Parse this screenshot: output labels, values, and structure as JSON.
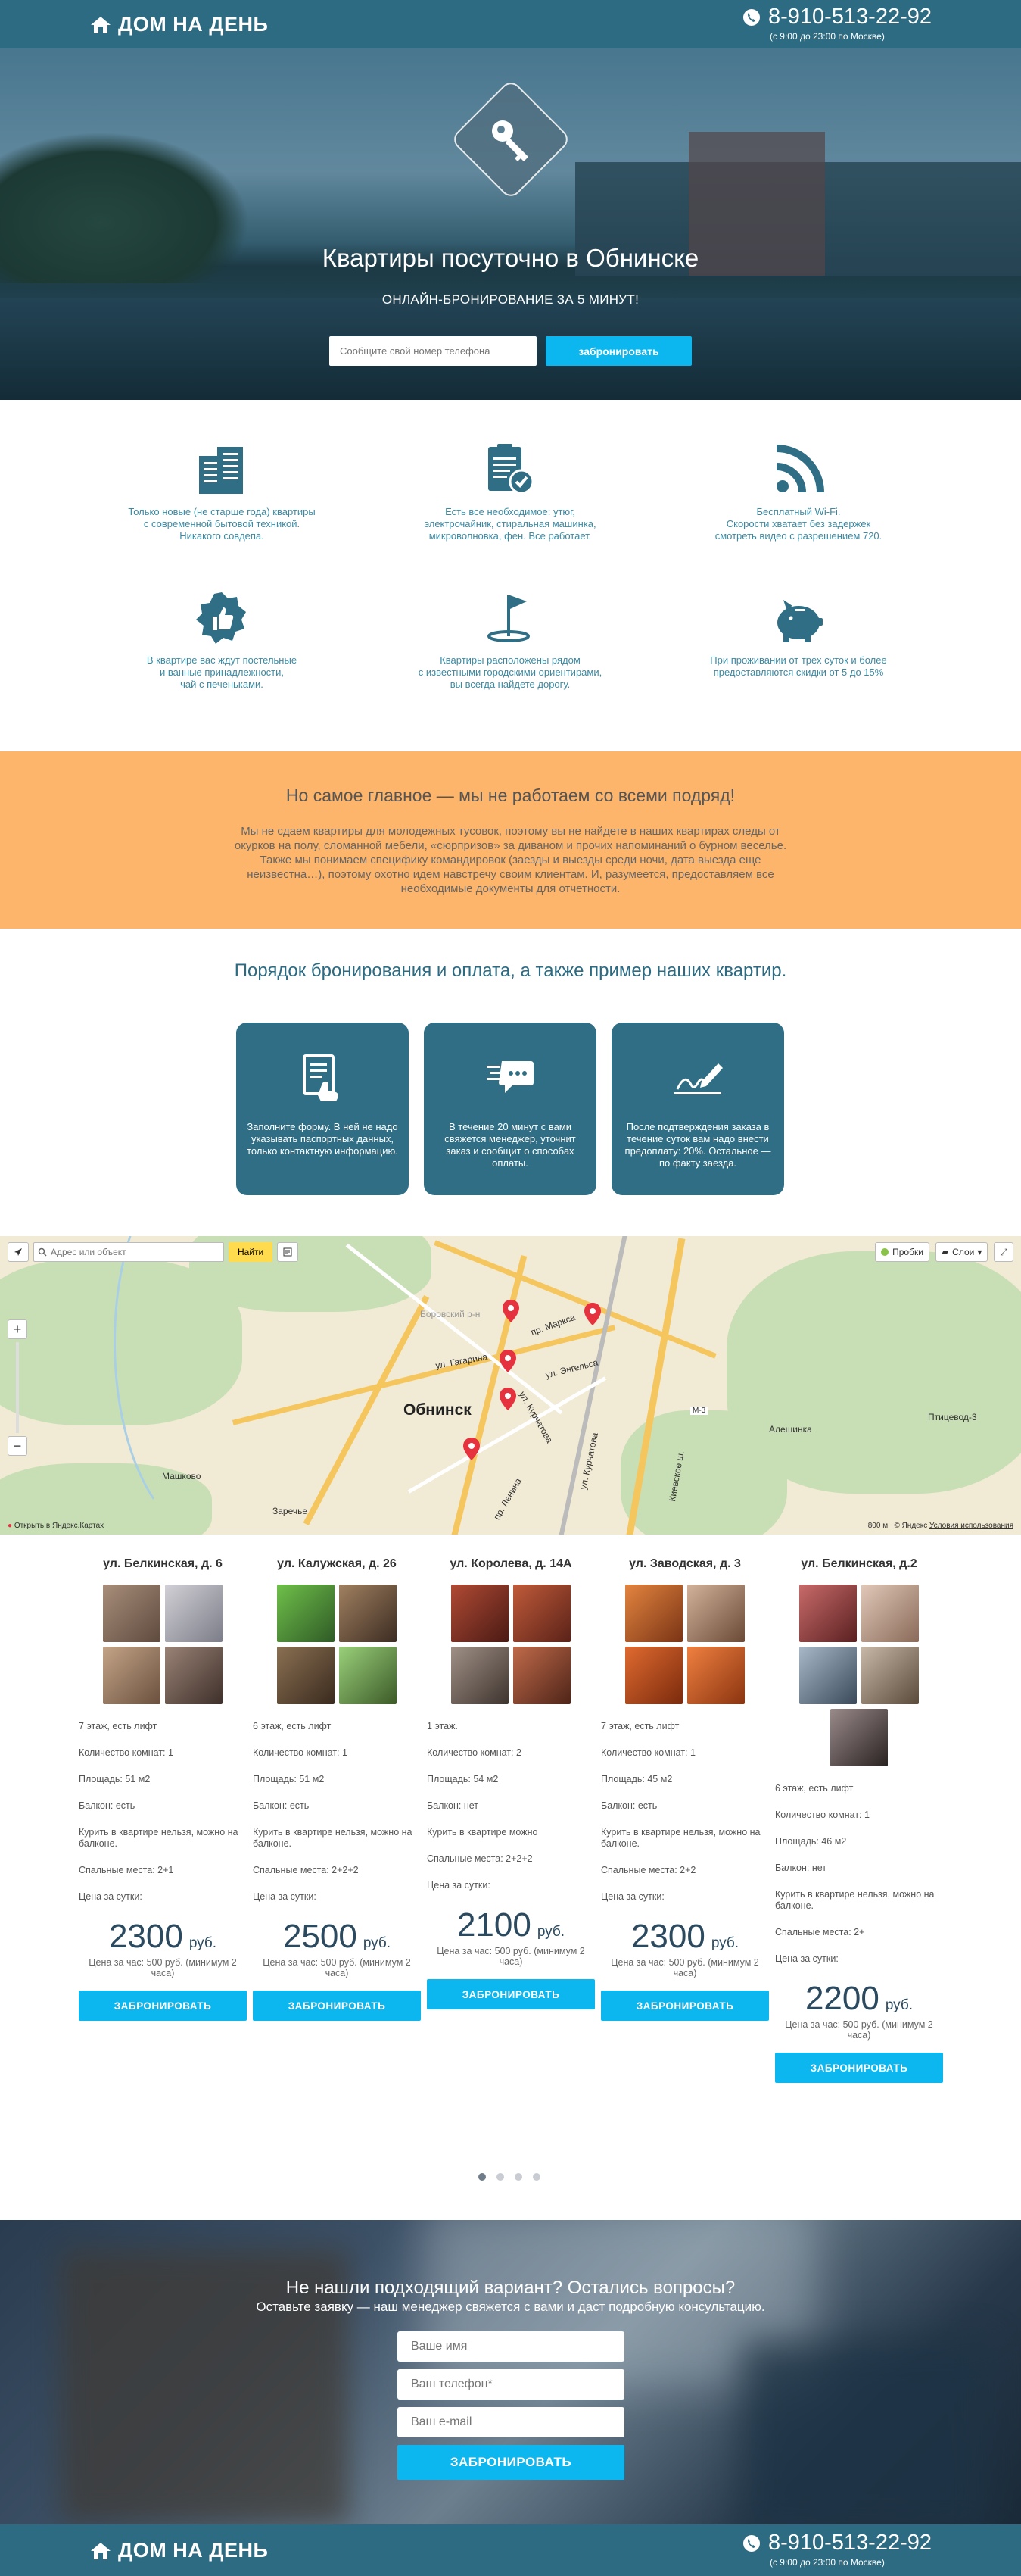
{
  "header": {
    "brand": "ДОМ НА ДЕНЬ",
    "phone": "8-910-513-22-92",
    "hours": "(с 9:00 до 23:00 по Москве)"
  },
  "hero": {
    "title": "Квартиры посуточно в Обнинске",
    "subtitle": "ОНЛАЙН-БРОНИРОВАНИЕ ЗА 5 МИНУТ!",
    "phone_placeholder": "Сообщите свой номер телефона",
    "book_label": "забронировать"
  },
  "features": [
    {
      "icon": "building-icon",
      "text": "Только новые (не старше года) квартиры\nс современной бытовой техникой.\nНикакого совдепа."
    },
    {
      "icon": "checklist-icon",
      "text": "Есть все необходимое: утюг,\nэлектрочайник, стиральная машинка,\nмикроволновка, фен. Все работает."
    },
    {
      "icon": "wifi-icon",
      "text": "Бесплатный Wi-Fi.\nСкорости хватает без задержек\nсмотреть видео с разрешением 720."
    },
    {
      "icon": "thumbs-up-icon",
      "text": "В квартире вас ждут постельные\nи ванные принадлежности,\nчай с печеньками."
    },
    {
      "icon": "flag-icon",
      "text": "Квартиры расположены рядом\nс известными городскими ориентирами,\nвы всегда найдете дорогу."
    },
    {
      "icon": "piggy-bank-icon",
      "text": "При проживании от трех суток и более\nпредоставляются скидки от 5 до 15%"
    }
  ],
  "notice": {
    "title": "Но самое главное — мы не работаем со всеми подряд!",
    "text": "Мы не сдаем квартиры для молодежных тусовок, поэтому вы не найдете в наших квартирах следы от окурков на полу, сломанной мебели, «сюрпризов» за диваном и прочих напоминаний о бурном веселье. Также мы понимаем специфику командировок (заезды и выезды среди ночи, дата выезда еще неизвестна…), поэтому охотно идем навстречу своим клиентам. И, разумеется, предоставляем все необходимые документы для отчетности."
  },
  "order": {
    "title": "Порядок бронирования и оплата, а также пример наших квартир.",
    "steps": [
      {
        "icon": "form-icon",
        "text": "Заполните форму. В ней не надо указывать паспортных данных, только контактную информацию."
      },
      {
        "icon": "chat-icon",
        "text": "В течение 20 минут с вами свяжется менеджер, уточнит заказ и сообщит о способах оплаты."
      },
      {
        "icon": "signature-icon",
        "text": "После подтверждения заказа в течение суток вам надо внести предоплату: 20%. Остальное — по факту заезда."
      }
    ]
  },
  "map": {
    "search_placeholder": "Адрес или объект",
    "find_label": "Найти",
    "traffic_label": "Пробки",
    "layers_label": "Слои",
    "city": "Обнинск",
    "labels": [
      "Боровский р-н",
      "пр. Маркса",
      "ул. Гагарина",
      "ул. Энгельса",
      "ул. Курчатова",
      "ул. Курчатова",
      "пр. Ленина",
      "Машково",
      "Заречье",
      "Алешинка",
      "Птицевод-3",
      "Киевское ш.",
      "М-3"
    ],
    "open_link": "Открыть в Яндекс.Картах",
    "scale": "800 м",
    "copyright": "© Яндекс",
    "terms": "Условия использования"
  },
  "listings": [
    {
      "address": "ул. Белкинская, д. 6",
      "floor": "7 этаж, есть лифт",
      "rooms": "Количество комнат: 1",
      "area": "Площадь: 51 м2",
      "balcony": "Балкон: есть",
      "smoking": "Курить в квартире нельзя, можно на балконе.",
      "beds": "Спальные места: 2+1",
      "price_label": "Цена за сутки:",
      "price": "2300",
      "currency": "руб.",
      "hourly": "Цена за час: 500 руб. (минимум 2 часа)",
      "button": "ЗАБРОНИРОВАТЬ",
      "photos": [
        "#7a6a5e",
        "#a9a9b0",
        "#8a6f58",
        "#6d5b53"
      ]
    },
    {
      "address": "ул. Калужская, д. 26",
      "floor": "6 этаж, есть лифт",
      "rooms": "Количество комнат: 1",
      "area": "Площадь: 51 м2",
      "balcony": "Балкон: есть",
      "smoking": "Курить в квартире нельзя, можно на балконе.",
      "beds": "Спальные места: 2+2+2",
      "price_label": "Цена за сутки:",
      "price": "2500",
      "currency": "руб.",
      "hourly": "Цена за час: 500 руб. (минимум 2 часа)",
      "button": "ЗАБРОНИРОВАТЬ",
      "photos": [
        "#4c8b3a",
        "#6a5446",
        "#5a4a3a",
        "#6fa04a"
      ]
    },
    {
      "address": "ул. Королева, д. 14А",
      "floor": "1 этаж.",
      "rooms": "Количество комнат: 2",
      "area": "Площадь: 54 м2",
      "balcony": "Балкон: нет",
      "smoking": "Курить в квартире можно",
      "beds": "Спальные места: 2+2+2",
      "price_label": "Цена за сутки:",
      "price": "2100",
      "currency": "руб.",
      "hourly": "Цена за час: 500 руб. (минимум 2 часа)",
      "button": "ЗАБРОНИРОВАТЬ",
      "photos": [
        "#7a2e22",
        "#8a3a2a",
        "#6a5a50",
        "#8a4a36"
      ]
    },
    {
      "address": "ул. Заводская, д. 3",
      "floor": "7 этаж, есть лифт",
      "rooms": "Количество комнат: 1",
      "area": "Площадь: 45 м2",
      "balcony": "Балкон: есть",
      "smoking": "Курить в квартире нельзя, можно на балконе.",
      "beds": "Спальные места: 2+2",
      "price_label": "Цена за сутки:",
      "price": "2300",
      "currency": "руб.",
      "hourly": "Цена за час: 500 руб. (минимум 2 часа)",
      "button": "ЗАБРОНИРОВАТЬ",
      "photos": [
        "#c9642a",
        "#b78a6a",
        "#c0531f",
        "#d0692c"
      ]
    },
    {
      "address": "ул. Белкинская, д.2",
      "floor": "6 этаж, есть лифт",
      "rooms": "Количество комнат: 1",
      "area": "Площадь: 46 м2",
      "balcony": "Балкон: нет",
      "smoking": "Курить в квартире нельзя, можно на балконе.",
      "beds": "Спальные места: 2+",
      "price_label": "Цена за сутки:",
      "price": "2200",
      "currency": "руб.",
      "hourly": "Цена за час: 500 руб. (минимум 2 часа)",
      "button": "ЗАБРОНИРОВАТЬ",
      "photos": [
        "#a04a4a",
        "#b8a090",
        "#7a8a9a",
        "#9a8a7a",
        "#6a5a5a"
      ]
    }
  ],
  "carousel": {
    "pages": 4,
    "active": 1
  },
  "cta": {
    "title": "Не нашли подходящий вариант? Остались вопросы?",
    "subtitle": "Оставьте заявку — наш менеджер свяжется с вами и даст подробную консультацию.",
    "name_placeholder": "Ваше имя",
    "phone_placeholder": "Ваш телефон*",
    "email_placeholder": "Ваш e-mail",
    "button": "ЗАБРОНИРОВАТЬ"
  },
  "colors": {
    "brand": "#2c6b82",
    "accent": "#0cb6ef",
    "notice_bg": "#fdb56c"
  }
}
